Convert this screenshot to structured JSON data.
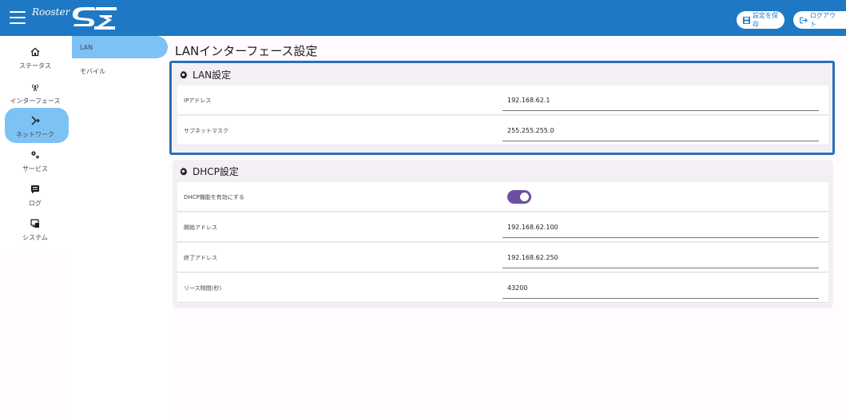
{
  "header": {
    "logo_text": "Rooster",
    "save_label": "設定を保存",
    "logout_label": "ログアウト",
    "accent": "#1e78c3"
  },
  "rail": {
    "items": [
      {
        "label": "ステータス",
        "icon": "home-icon"
      },
      {
        "label": "インターフェース",
        "icon": "antenna-icon",
        "active": true
      },
      {
        "label": "ネットワーク",
        "icon": "network-icon"
      },
      {
        "label": "サービス",
        "icon": "gears-icon"
      },
      {
        "label": "ログ",
        "icon": "message-icon"
      },
      {
        "label": "システム",
        "icon": "system-icon"
      }
    ]
  },
  "subnav": {
    "items": [
      {
        "label": "LAN",
        "active": true
      },
      {
        "label": "モバイル"
      }
    ]
  },
  "main": {
    "title": "LANインターフェース設定",
    "lan_card": {
      "title": "LAN設定",
      "rows": [
        {
          "label": "IPアドレス",
          "value": "192.168.62.1"
        },
        {
          "label": "サブネットマスク",
          "value": "255.255.255.0"
        }
      ]
    },
    "dhcp_card": {
      "title": "DHCP設定",
      "toggle_label": "DHCP機能を有効にする",
      "toggle_on": true,
      "rows": [
        {
          "label": "開始アドレス",
          "value": "192.168.62.100"
        },
        {
          "label": "終了アドレス",
          "value": "192.168.62.250"
        },
        {
          "label": "リース時間(秒)",
          "value": "43200"
        }
      ]
    }
  }
}
